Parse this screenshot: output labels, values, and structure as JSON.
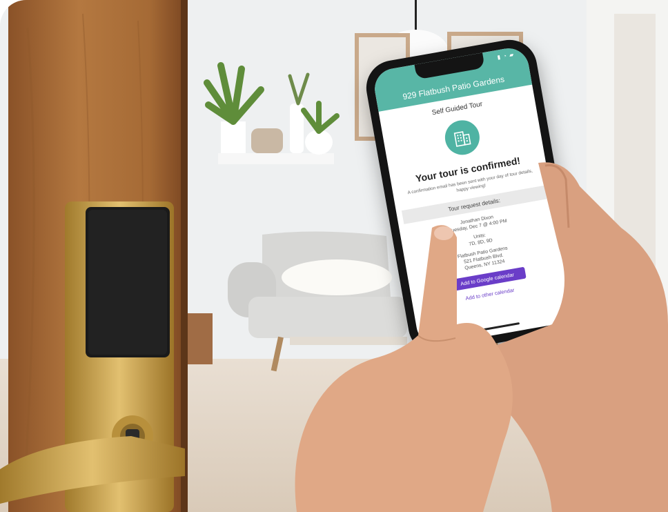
{
  "phone_app": {
    "header_title": "929 Flatbush Patio Gardens",
    "page_subtitle": "Self Guided Tour",
    "building_icon": "building-icon",
    "confirmation_headline": "Your tour is confirmed!",
    "confirmation_note": "A confirmation email has been sent with your day of tour details, happy viewing!",
    "details_header": "Tour request details:",
    "details": {
      "name": "Jonathan Dixon",
      "datetime": "Tuesday, Dec 7 @ 4:00 PM",
      "units_label": "Units:",
      "units": "7D, 8D, 9D",
      "property_name": "Flatbush Patio Gardens",
      "address_line1": "521 Flatbush Blvd.",
      "address_line2": "Queens, NY 11324"
    },
    "google_calendar_button": "Add to Google calendar",
    "other_calendar_link": "Add to other calendar"
  },
  "colors": {
    "header_teal": "#58b6a6",
    "accent_purple": "#6a3dc8",
    "door_wood": "#a86a3a",
    "lock_gold": "#c9a24a"
  }
}
